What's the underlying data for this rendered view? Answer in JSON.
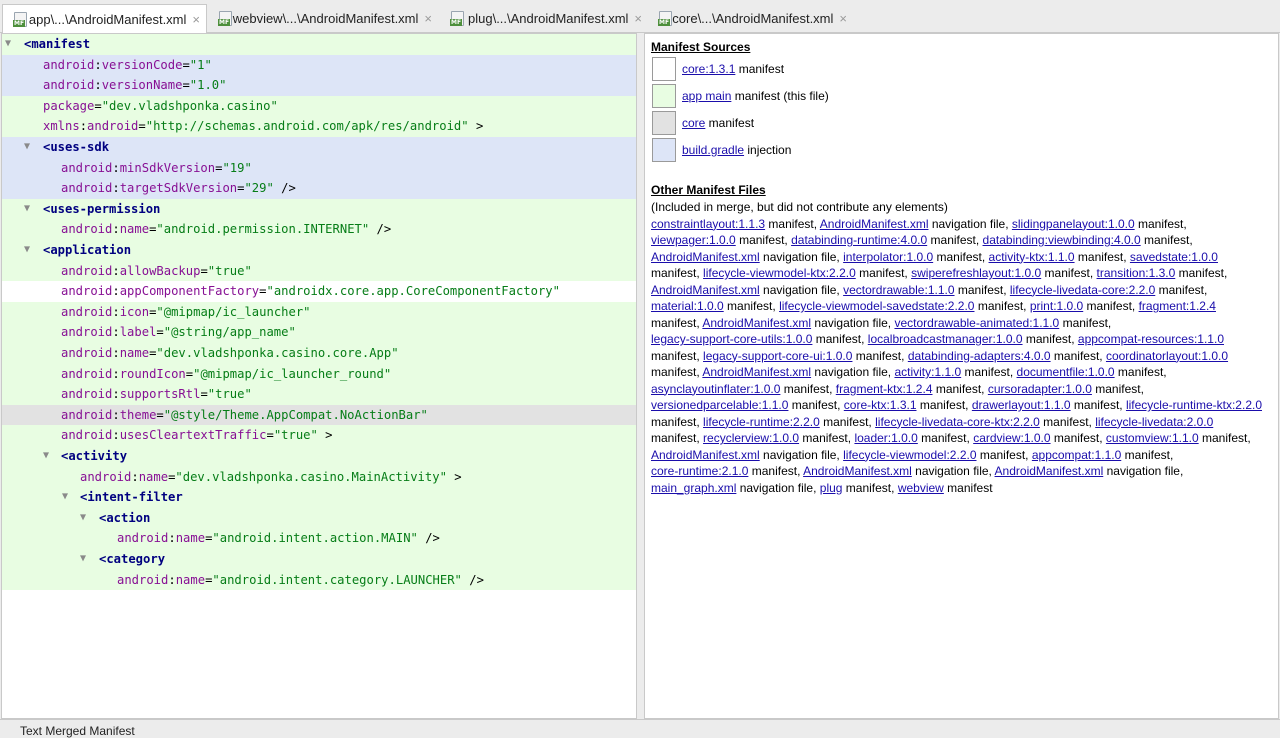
{
  "tabs": [
    {
      "label": "app\\...\\AndroidManifest.xml",
      "close": "×",
      "active": true
    },
    {
      "label": "webview\\...\\AndroidManifest.xml",
      "close": "×",
      "active": false
    },
    {
      "label": "plug\\...\\AndroidManifest.xml",
      "close": "×",
      "active": false
    },
    {
      "label": "core\\...\\AndroidManifest.xml",
      "close": "×",
      "active": false
    }
  ],
  "file_icon_label": "MF",
  "fold_marker": "▼",
  "xml": {
    "manifest": {
      "tag": "<manifest"
    },
    "versionCode": {
      "ns": "android",
      "attr": "versionCode",
      "value": "\"1\""
    },
    "versionName": {
      "ns": "android",
      "attr": "versionName",
      "value": "\"1.0\""
    },
    "package": {
      "attr": "package",
      "value": "\"dev.vladshponka.casino\""
    },
    "xmlns": {
      "ns": "xmlns",
      "attr": "android",
      "value": "\"http://schemas.android.com/apk/res/android\"",
      "close": " >"
    },
    "usesSdk": {
      "tag": "<uses-sdk"
    },
    "minSdk": {
      "ns": "android",
      "attr": "minSdkVersion",
      "value": "\"19\""
    },
    "targetSdk": {
      "ns": "android",
      "attr": "targetSdkVersion",
      "value": "\"29\"",
      "close": " />"
    },
    "usesPermission": {
      "tag": "<uses-permission"
    },
    "permName": {
      "ns": "android",
      "attr": "name",
      "value": "\"android.permission.INTERNET\"",
      "close": " />"
    },
    "application": {
      "tag": "<application"
    },
    "allowBackup": {
      "ns": "android",
      "attr": "allowBackup",
      "value": "\"true\""
    },
    "appComponentFactory": {
      "ns": "android",
      "attr": "appComponentFactory",
      "value": "\"androidx.core.app.CoreComponentFactory\""
    },
    "icon": {
      "ns": "android",
      "attr": "icon",
      "value": "\"@mipmap/ic_launcher\""
    },
    "label": {
      "ns": "android",
      "attr": "label",
      "value": "\"@string/app_name\""
    },
    "appName": {
      "ns": "android",
      "attr": "name",
      "value": "\"dev.vladshponka.casino.core.App\""
    },
    "roundIcon": {
      "ns": "android",
      "attr": "roundIcon",
      "value": "\"@mipmap/ic_launcher_round\""
    },
    "supportsRtl": {
      "ns": "android",
      "attr": "supportsRtl",
      "value": "\"true\""
    },
    "theme": {
      "ns": "android",
      "attr": "theme",
      "value": "\"@style/Theme.AppCompat.NoActionBar\""
    },
    "cleartext": {
      "ns": "android",
      "attr": "usesCleartextTraffic",
      "value": "\"true\"",
      "close": " >"
    },
    "activity": {
      "tag": "<activity"
    },
    "activityName": {
      "ns": "android",
      "attr": "name",
      "value": "\"dev.vladshponka.casino.MainActivity\"",
      "close": " >"
    },
    "intentFilter": {
      "tag": "<intent-filter"
    },
    "action": {
      "tag": "<action"
    },
    "actionName": {
      "ns": "android",
      "attr": "name",
      "value": "\"android.intent.action.MAIN\"",
      "close": " />"
    },
    "category": {
      "tag": "<category"
    },
    "categoryName": {
      "ns": "android",
      "attr": "name",
      "value": "\"android.intent.category.LAUNCHER\"",
      "close": " />"
    }
  },
  "right": {
    "sources_title": "Manifest Sources",
    "sources": [
      {
        "link": "core:1.3.1",
        "text": " manifest",
        "color": "#ffffff"
      },
      {
        "link": "app main",
        "text": " manifest (this file)",
        "color": "#e8fde2"
      },
      {
        "link": "core",
        "text": " manifest",
        "color": "#e2e2e2"
      },
      {
        "link": "build.gradle",
        "text": " injection",
        "color": "#dde5f7"
      }
    ],
    "other_title": "Other Manifest Files",
    "other_note": "(Included in merge, but did not contribute any elements)",
    "lines": [
      [
        [
          "constraintlayout:1.1.3",
          " manifest, "
        ],
        [
          "AndroidManifest.xml",
          " navigation file, "
        ],
        [
          "slidingpanelayout:1.0.0",
          " manifest,"
        ]
      ],
      [
        [
          "viewpager:1.0.0",
          " manifest, "
        ],
        [
          "databinding-runtime:4.0.0",
          " manifest, "
        ],
        [
          "databinding:viewbinding:4.0.0",
          " manifest,"
        ]
      ],
      [
        [
          "AndroidManifest.xml",
          " navigation file, "
        ],
        [
          "interpolator:1.0.0",
          " manifest, "
        ],
        [
          "activity-ktx:1.1.0",
          " manifest, "
        ],
        [
          "savedstate:1.0.0",
          ""
        ]
      ],
      [
        [
          "",
          "manifest, "
        ],
        [
          "lifecycle-viewmodel-ktx:2.2.0",
          " manifest, "
        ],
        [
          "swiperefreshlayout:1.0.0",
          " manifest, "
        ],
        [
          "transition:1.3.0",
          " manifest,"
        ]
      ],
      [
        [
          "AndroidManifest.xml",
          " navigation file, "
        ],
        [
          "vectordrawable:1.1.0",
          " manifest, "
        ],
        [
          "lifecycle-livedata-core:2.2.0",
          " manifest,"
        ]
      ],
      [
        [
          "material:1.0.0",
          " manifest, "
        ],
        [
          "lifecycle-viewmodel-savedstate:2.2.0",
          " manifest, "
        ],
        [
          "print:1.0.0",
          " manifest, "
        ],
        [
          "fragment:1.2.4",
          ""
        ]
      ],
      [
        [
          "",
          "manifest, "
        ],
        [
          "AndroidManifest.xml",
          " navigation file, "
        ],
        [
          "vectordrawable-animated:1.1.0",
          " manifest,"
        ]
      ],
      [
        [
          "legacy-support-core-utils:1.0.0",
          " manifest, "
        ],
        [
          "localbroadcastmanager:1.0.0",
          " manifest, "
        ],
        [
          "appcompat-resources:1.1.0",
          ""
        ]
      ],
      [
        [
          "",
          "manifest, "
        ],
        [
          "legacy-support-core-ui:1.0.0",
          " manifest, "
        ],
        [
          "databinding-adapters:4.0.0",
          " manifest, "
        ],
        [
          "coordinatorlayout:1.0.0",
          ""
        ]
      ],
      [
        [
          "",
          "manifest, "
        ],
        [
          "AndroidManifest.xml",
          " navigation file, "
        ],
        [
          "activity:1.1.0",
          " manifest, "
        ],
        [
          "documentfile:1.0.0",
          " manifest,"
        ]
      ],
      [
        [
          "asynclayoutinflater:1.0.0",
          " manifest, "
        ],
        [
          "fragment-ktx:1.2.4",
          " manifest, "
        ],
        [
          "cursoradapter:1.0.0",
          " manifest,"
        ]
      ],
      [
        [
          "versionedparcelable:1.1.0",
          " manifest, "
        ],
        [
          "core-ktx:1.3.1",
          " manifest, "
        ],
        [
          "drawerlayout:1.1.0",
          " manifest, "
        ],
        [
          "lifecycle-runtime-ktx:2.2.0",
          ""
        ]
      ],
      [
        [
          "",
          "manifest, "
        ],
        [
          "lifecycle-runtime:2.2.0",
          " manifest, "
        ],
        [
          "lifecycle-livedata-core-ktx:2.2.0",
          " manifest, "
        ],
        [
          "lifecycle-livedata:2.0.0",
          ""
        ]
      ],
      [
        [
          "",
          "manifest, "
        ],
        [
          "recyclerview:1.0.0",
          " manifest, "
        ],
        [
          "loader:1.0.0",
          " manifest, "
        ],
        [
          "cardview:1.0.0",
          " manifest, "
        ],
        [
          "customview:1.1.0",
          " manifest,"
        ]
      ],
      [
        [
          "AndroidManifest.xml",
          " navigation file, "
        ],
        [
          "lifecycle-viewmodel:2.2.0",
          " manifest, "
        ],
        [
          "appcompat:1.1.0",
          " manifest,"
        ]
      ],
      [
        [
          "core-runtime:2.1.0",
          " manifest, "
        ],
        [
          "AndroidManifest.xml",
          " navigation file, "
        ],
        [
          "AndroidManifest.xml",
          " navigation file,"
        ]
      ],
      [
        [
          "main_graph.xml",
          " navigation file, "
        ],
        [
          "plug",
          " manifest, "
        ],
        [
          "webview",
          " manifest"
        ]
      ]
    ]
  },
  "bottom_tabs": "Text    Merged Manifest"
}
